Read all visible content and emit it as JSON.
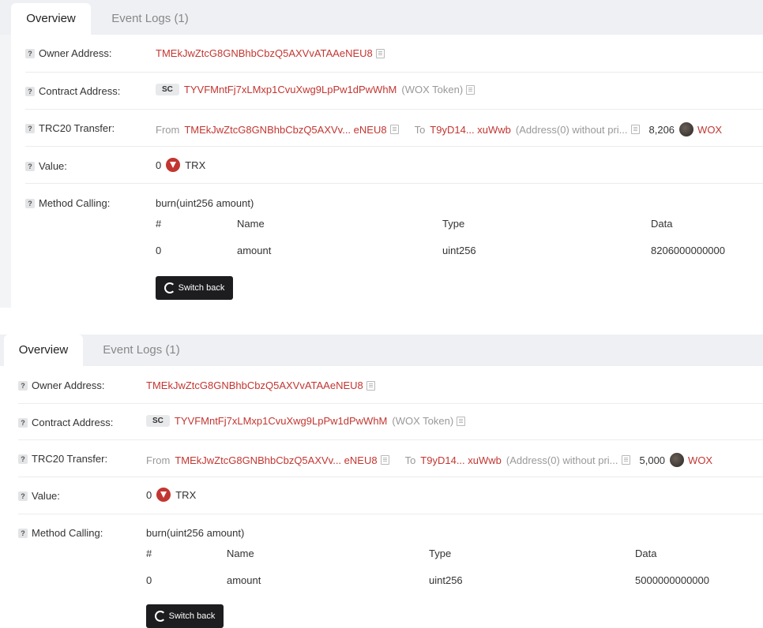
{
  "panels": [
    {
      "tabs": {
        "overview": "Overview",
        "events": "Event Logs (1)"
      },
      "owner": {
        "label": "Owner Address:",
        "address": "TMEkJwZtcG8GNBhbCbzQ5AXVvATAAeNEU8"
      },
      "contract": {
        "label": "Contract Address:",
        "badge": "SC",
        "address": "TYVFMntFj7xLMxp1CvuXwg9LpPw1dPwWhM",
        "name": "(WOX Token)"
      },
      "transfer": {
        "label": "TRC20 Transfer:",
        "from_label": "From",
        "from": "TMEkJwZtcG8GNBhbCbzQ5AXVv... eNEU8",
        "to_label": "To",
        "to": "T9yD14... xuWwb",
        "to_note": "(Address(0) without pri...",
        "amount": "8,206",
        "token": "WOX"
      },
      "value": {
        "label": "Value:",
        "amount": "0",
        "unit": "TRX"
      },
      "method": {
        "label": "Method Calling:",
        "signature": "burn(uint256 amount)",
        "headers": [
          "#",
          "Name",
          "Type",
          "Data"
        ],
        "row": [
          "0",
          "amount",
          "uint256",
          "8206000000000"
        ],
        "button": "Switch back"
      }
    },
    {
      "tabs": {
        "overview": "Overview",
        "events": "Event Logs (1)"
      },
      "owner": {
        "label": "Owner Address:",
        "address": "TMEkJwZtcG8GNBhbCbzQ5AXVvATAAeNEU8"
      },
      "contract": {
        "label": "Contract Address:",
        "badge": "SC",
        "address": "TYVFMntFj7xLMxp1CvuXwg9LpPw1dPwWhM",
        "name": "(WOX Token)"
      },
      "transfer": {
        "label": "TRC20 Transfer:",
        "from_label": "From",
        "from": "TMEkJwZtcG8GNBhbCbzQ5AXVv... eNEU8",
        "to_label": "To",
        "to": "T9yD14... xuWwb",
        "to_note": "(Address(0) without pri...",
        "amount": "5,000",
        "token": "WOX"
      },
      "value": {
        "label": "Value:",
        "amount": "0",
        "unit": "TRX"
      },
      "method": {
        "label": "Method Calling:",
        "signature": "burn(uint256 amount)",
        "headers": [
          "#",
          "Name",
          "Type",
          "Data"
        ],
        "row": [
          "0",
          "amount",
          "uint256",
          "5000000000000"
        ],
        "button": "Switch back"
      }
    }
  ],
  "colors": {
    "accent": "#c23631",
    "tabbar": "#eef0f4",
    "button": "#1d1d1f"
  }
}
